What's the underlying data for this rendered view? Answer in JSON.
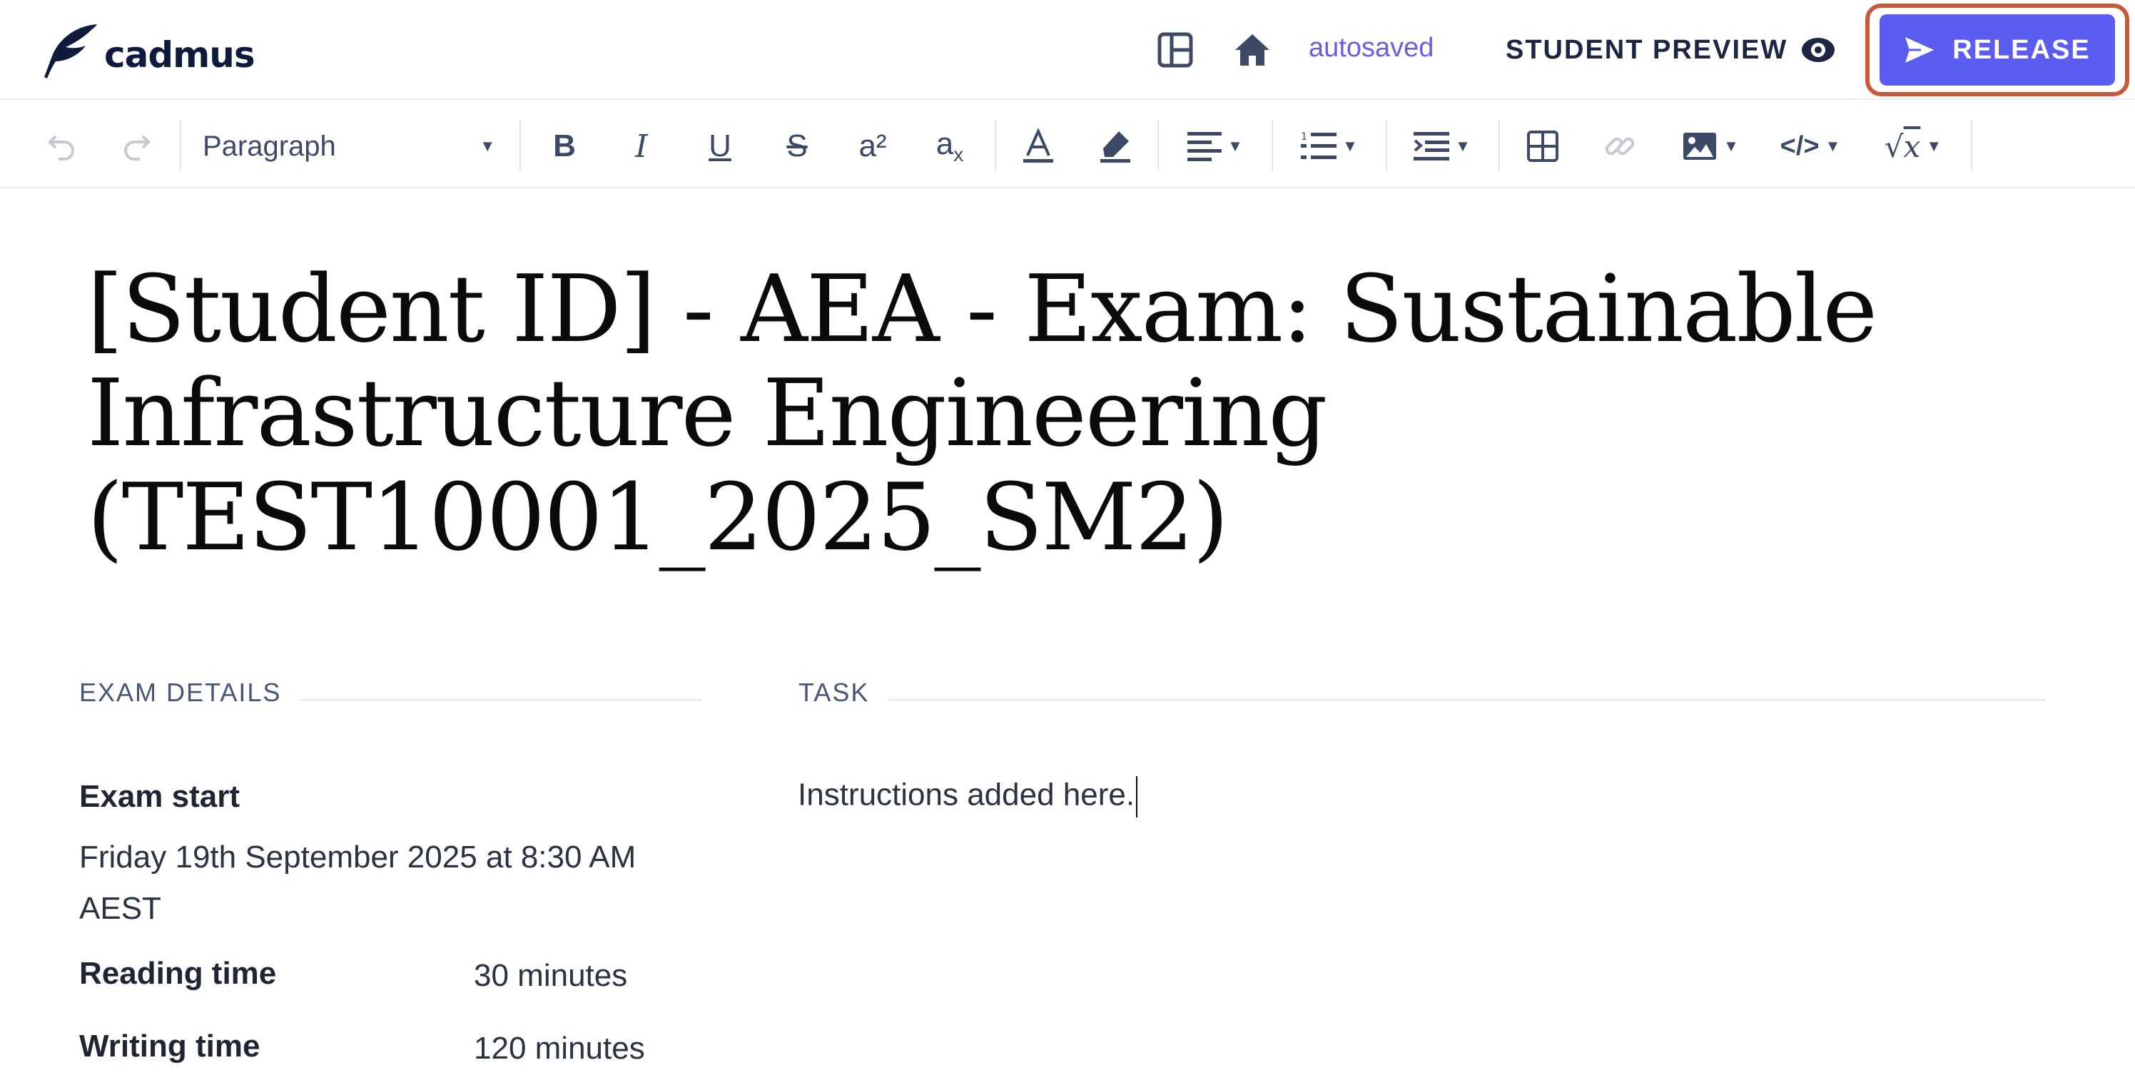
{
  "header": {
    "logo_text": "cadmus",
    "status": "autosaved",
    "preview_label": "STUDENT PREVIEW",
    "release_label": "RELEASE",
    "icons": [
      "layout-panel-icon",
      "home-icon",
      "eye-icon",
      "send-icon"
    ]
  },
  "toolbar": {
    "block_style": "Paragraph",
    "superscript_label": "a²",
    "subscript_base": "a",
    "subscript_sub": "x",
    "tools": [
      "undo",
      "redo",
      "bold",
      "italic",
      "underline",
      "strikethrough",
      "superscript",
      "subscript",
      "font-color",
      "highlight",
      "align",
      "numbered-list",
      "indent",
      "table",
      "link",
      "image",
      "code",
      "math"
    ]
  },
  "document": {
    "title": "[Student ID] - AEA - Exam: Sustainable Infrastructure Engineering (TEST10001_2025_SM2)",
    "details": {
      "heading": "EXAM DETAILS",
      "exam_start_label": "Exam start",
      "exam_start_value": "Friday 19th September 2025 at 8:30 AM AEST",
      "reading_time_label": "Reading time",
      "reading_time_value": "30 minutes",
      "writing_time_label": "Writing time",
      "writing_time_value": "120 minutes"
    },
    "task": {
      "heading": "TASK",
      "text": "Instructions added here."
    }
  },
  "colors": {
    "accent": "#5b5cf0",
    "highlight_border": "#c65a3a",
    "autosaved": "#6c5ce7",
    "navy": "#1c2541"
  }
}
